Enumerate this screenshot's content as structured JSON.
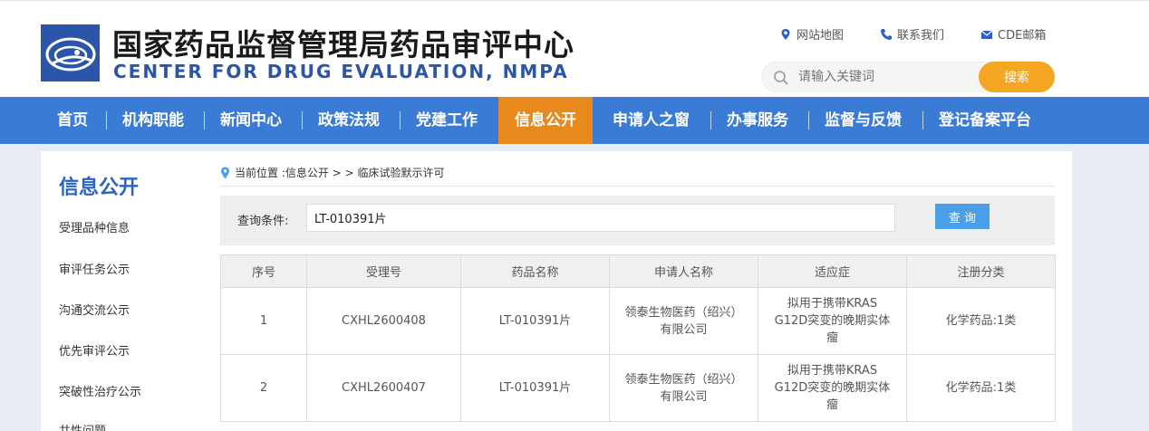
{
  "header": {
    "title_cn": "国家药品监督管理局药品审评中心",
    "title_en": "CENTER FOR DRUG EVALUATION, NMPA",
    "links": [
      {
        "label": "网站地图",
        "icon": "location-pin-icon"
      },
      {
        "label": "联系我们",
        "icon": "phone-icon"
      },
      {
        "label": "CDE邮箱",
        "icon": "mail-icon"
      }
    ],
    "search": {
      "placeholder": "请输入关键词",
      "button": "搜索"
    }
  },
  "nav": {
    "items": [
      "首页",
      "机构职能",
      "新闻中心",
      "政策法规",
      "党建工作",
      "信息公开",
      "申请人之窗",
      "办事服务",
      "监督与反馈",
      "登记备案平台"
    ],
    "active": "信息公开"
  },
  "sidebar": {
    "title": "信息公开",
    "items": [
      "受理品种信息",
      "审评任务公示",
      "沟通交流公示",
      "优先审评公示",
      "突破性治疗公示",
      "共性问题"
    ]
  },
  "breadcrumb": {
    "prefix": "当前位置 : ",
    "path": "信息公开",
    "sep": " > > ",
    "current": "临床试验默示许可"
  },
  "query": {
    "label": "查询条件:",
    "value": "LT-010391片",
    "button": "查 询"
  },
  "table": {
    "headers": [
      "序号",
      "受理号",
      "药品名称",
      "申请人名称",
      "适应症",
      "注册分类"
    ],
    "rows": [
      [
        "1",
        "CXHL2600408",
        "LT-010391片",
        "领泰生物医药（绍兴）有限公司",
        "拟用于携带KRAS G12D突变的晚期实体瘤",
        "化学药品:1类"
      ],
      [
        "2",
        "CXHL2600407",
        "LT-010391片",
        "领泰生物医药（绍兴）有限公司",
        "拟用于携带KRAS G12D突变的晚期实体瘤",
        "化学药品:1类"
      ]
    ]
  },
  "colors": {
    "brand_blue": "#2a55a8",
    "nav_blue": "#3a7bd5",
    "active_orange": "#e8891e",
    "search_orange": "#f5a623",
    "query_button": "#4b9fe8"
  }
}
